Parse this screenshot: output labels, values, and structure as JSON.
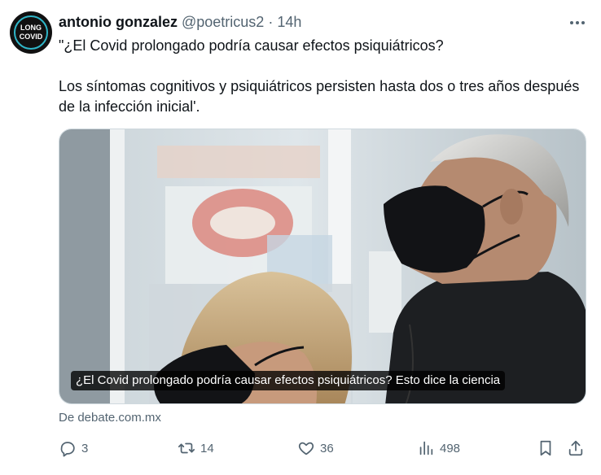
{
  "tweet": {
    "author": {
      "name": "antonio gonzalez",
      "handle": "@poetricus2",
      "separator": "·",
      "time": "14h",
      "avatar": {
        "top_text": "LONG COVID",
        "line1": "LONG",
        "line2": "COVID",
        "ring_color": "#2fb6c8"
      }
    },
    "text_line1": "\"¿El Covid prolongado podría causar efectos psiquiátricos?",
    "text_line2": "Los síntomas cognitivos y psiquiátricos persisten hasta dos o tres años después de la infección inicial'.",
    "card": {
      "caption": "¿El Covid prolongado podría causar efectos psiquiátricos? Esto dice la ciencia",
      "source": "De debate.com.mx"
    },
    "actions": {
      "replies": "3",
      "retweets": "14",
      "likes": "36",
      "views": "498"
    },
    "icons": {
      "more": "more-horizontal-icon",
      "reply": "reply-icon",
      "retweet": "retweet-icon",
      "like": "heart-icon",
      "views": "analytics-icon",
      "bookmark": "bookmark-icon",
      "share": "share-icon"
    }
  }
}
